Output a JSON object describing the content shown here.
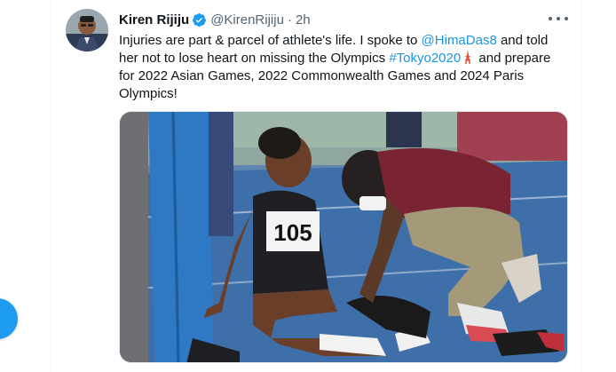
{
  "tweet": {
    "author_name": "Kiren Rijiju",
    "handle": "@KirenRijiju",
    "separator": "·",
    "time": "2h",
    "text_part1": "Injuries are part & parcel of athlete's life. I spoke to ",
    "mention": "@HimaDas8",
    "text_part2": " and told her not to lose heart on missing the Olympics ",
    "hashtag": "#Tokyo2020",
    "text_part3": "  and prepare for 2022 Asian Games, 2022 Commonwealth Games and 2024 Paris Olympics!",
    "bib_number": "105"
  },
  "icons": {
    "verified": "verified-badge-icon",
    "more": "more-options-icon",
    "emoji": "tokyo-tower-emoji"
  },
  "colors": {
    "link": "#1b95e0",
    "verified": "#1d9bf0",
    "fab": "#1d9bf0",
    "track": "#3f6fa8"
  }
}
